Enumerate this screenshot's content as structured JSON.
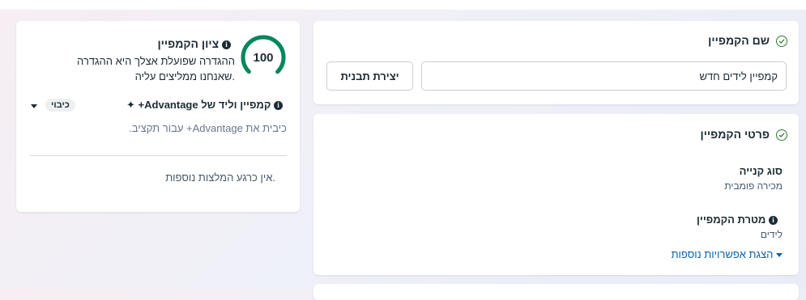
{
  "campaign_name_card": {
    "title": "שם הקמפיין",
    "name_value": "קמפיין לידים חדש",
    "create_template_label": "יצירת תבנית"
  },
  "campaign_details_card": {
    "title": "פרטי הקמפיין",
    "buying_type_label": "סוג קנייה",
    "buying_type_value": "מכירה פומבית",
    "objective_label": "מטרת הקמפיין",
    "objective_value": "לידים",
    "more_options_link": "הצגת אפשרויות נוספות"
  },
  "score_card": {
    "score": 100,
    "score_fraction": 1.0,
    "title": "ציון הקמפיין",
    "description_line1": "ההגדרה שפועלת אצלך היא ההגדרה",
    "description_line2": "שאנחנו ממליצים עליה.",
    "advantage_title": "קמפיין וליד של Advantage+",
    "toggle_badge": "כיבוי",
    "advantage_desc": "כיבית את Advantage+ עבור תקציב.",
    "no_recommendations": "אין כרגע המלצות נוספות."
  },
  "colors": {
    "accent_green": "#2e7d32",
    "score_ring": "#00875a",
    "link_blue": "#0a61a8"
  }
}
